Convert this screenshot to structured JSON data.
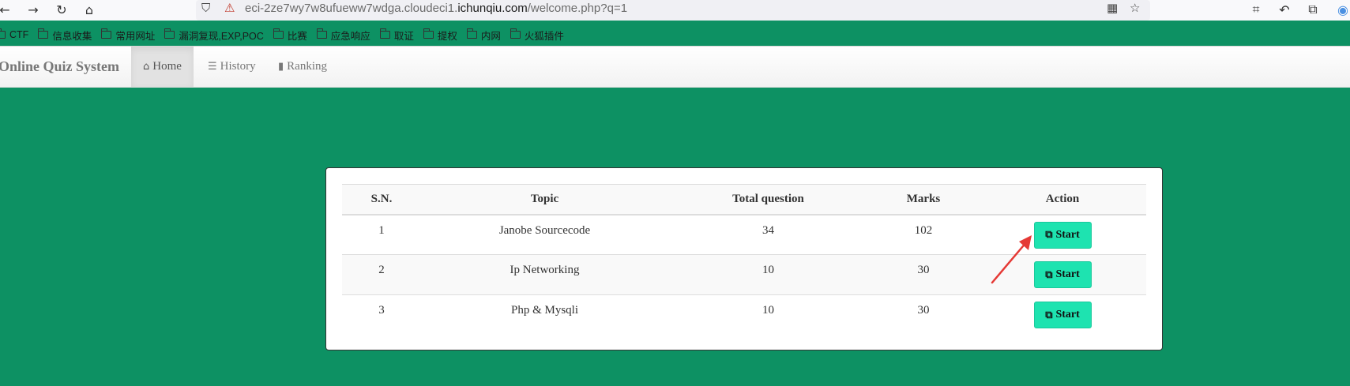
{
  "browser": {
    "url_prefix": "eci-2ze7wy7w8ufueww7wdga.cloudeci1.",
    "url_domain": "ichunqiu.com",
    "url_suffix": "/welcome.php?q=1",
    "bookmarks": [
      "CTF",
      "信息收集",
      "常用网址",
      "漏洞复现,EXP,POC",
      "比赛",
      "应急响应",
      "取证",
      "提权",
      "内网",
      "火狐插件"
    ]
  },
  "navbar": {
    "brand": "Online Quiz System",
    "items": [
      {
        "label": "Home",
        "icon": "home-icon"
      },
      {
        "label": "History",
        "icon": "list-icon"
      },
      {
        "label": "Ranking",
        "icon": "bar-chart-icon"
      }
    ]
  },
  "table": {
    "headers": [
      "S.N.",
      "Topic",
      "Total question",
      "Marks",
      "Action"
    ],
    "rows": [
      {
        "sn": "1",
        "topic": "Janobe Sourcecode",
        "total": "34",
        "marks": "102",
        "action": "Start"
      },
      {
        "sn": "2",
        "topic": "Ip Networking",
        "total": "10",
        "marks": "30",
        "action": "Start"
      },
      {
        "sn": "3",
        "topic": "Php & Mysqli",
        "total": "10",
        "marks": "30",
        "action": "Start"
      }
    ]
  },
  "colors": {
    "background": "#0d9163",
    "start_button": "#1ee3b0",
    "annotation_arrow": "#e53935"
  }
}
